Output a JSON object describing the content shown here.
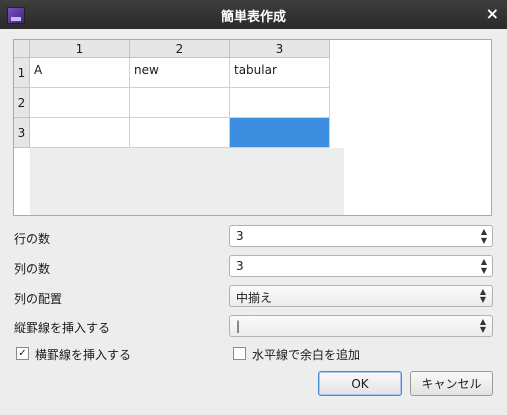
{
  "window": {
    "title": "簡単表作成",
    "close_icon": "×"
  },
  "table": {
    "columns": [
      "1",
      "2",
      "3"
    ],
    "rows": [
      "1",
      "2",
      "3"
    ],
    "cells": [
      [
        "A",
        "new",
        "tabular"
      ],
      [
        "",
        "",
        ""
      ],
      [
        "",
        "",
        ""
      ]
    ]
  },
  "form": {
    "rows_label": "行の数",
    "rows_value": "3",
    "cols_label": "列の数",
    "cols_value": "3",
    "align_label": "列の配置",
    "align_value": "中揃え",
    "vlines_label": "縦罫線を挿入する",
    "vlines_value": "|",
    "hlines_label": "横罫線を挿入する",
    "hlines_checked": "✓",
    "space_label": "水平線で余白を追加"
  },
  "buttons": {
    "ok": "OK",
    "cancel": "キャンセル"
  },
  "colors": {
    "selection": "#3e8edf",
    "titlebar": "#2f2f2f"
  }
}
